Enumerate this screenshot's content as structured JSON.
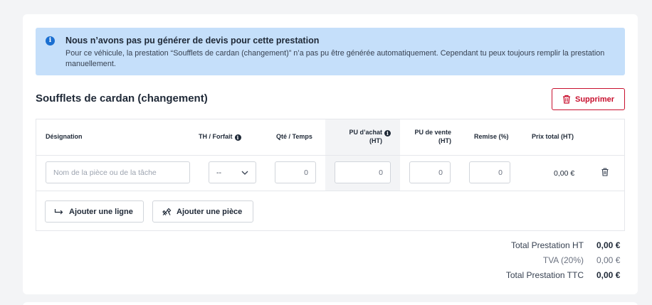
{
  "alert": {
    "icon": "info-icon",
    "title": "Nous n’avons pas pu générer de devis pour cette prestation",
    "text": "Pour ce véhicule, la prestation “Soufflets de cardan (changement)” n’a pas pu être générée automatiquement. Cependant tu peux toujours remplir la prestation manuellement."
  },
  "section": {
    "title": "Soufflets de cardan (changement)",
    "delete_label": "Supprimer"
  },
  "table": {
    "headers": {
      "designation": "Désignation",
      "th_forfait": "TH / Forfait",
      "qte_temps": "Qté / Temps",
      "pu_achat_1": "PU d’achat",
      "pu_achat_2": "(HT)",
      "pu_vente_1": "PU de vente",
      "pu_vente_2": "(HT)",
      "remise": "Remise (%)",
      "prix_total": "Prix total (HT)"
    },
    "row": {
      "designation_placeholder": "Nom de la pièce ou de la tâche",
      "th_forfait_value": "--",
      "qte": "0",
      "pu_achat": "0",
      "pu_vente": "0",
      "remise": "0",
      "total": "0,00 €"
    }
  },
  "actions": {
    "add_line": "Ajouter une ligne",
    "add_piece": "Ajouter une pièce"
  },
  "summary": {
    "total_ht_label": "Total Prestation HT",
    "total_ht_value": "0,00 €",
    "tva_label": "TVA (20%)",
    "tva_value": "0,00 €",
    "total_ttc_label": "Total Prestation TTC",
    "total_ttc_value": "0,00 €"
  },
  "colors": {
    "alert_bg": "#c5dffa",
    "danger": "#c8102e",
    "info": "#1a6fd1"
  }
}
